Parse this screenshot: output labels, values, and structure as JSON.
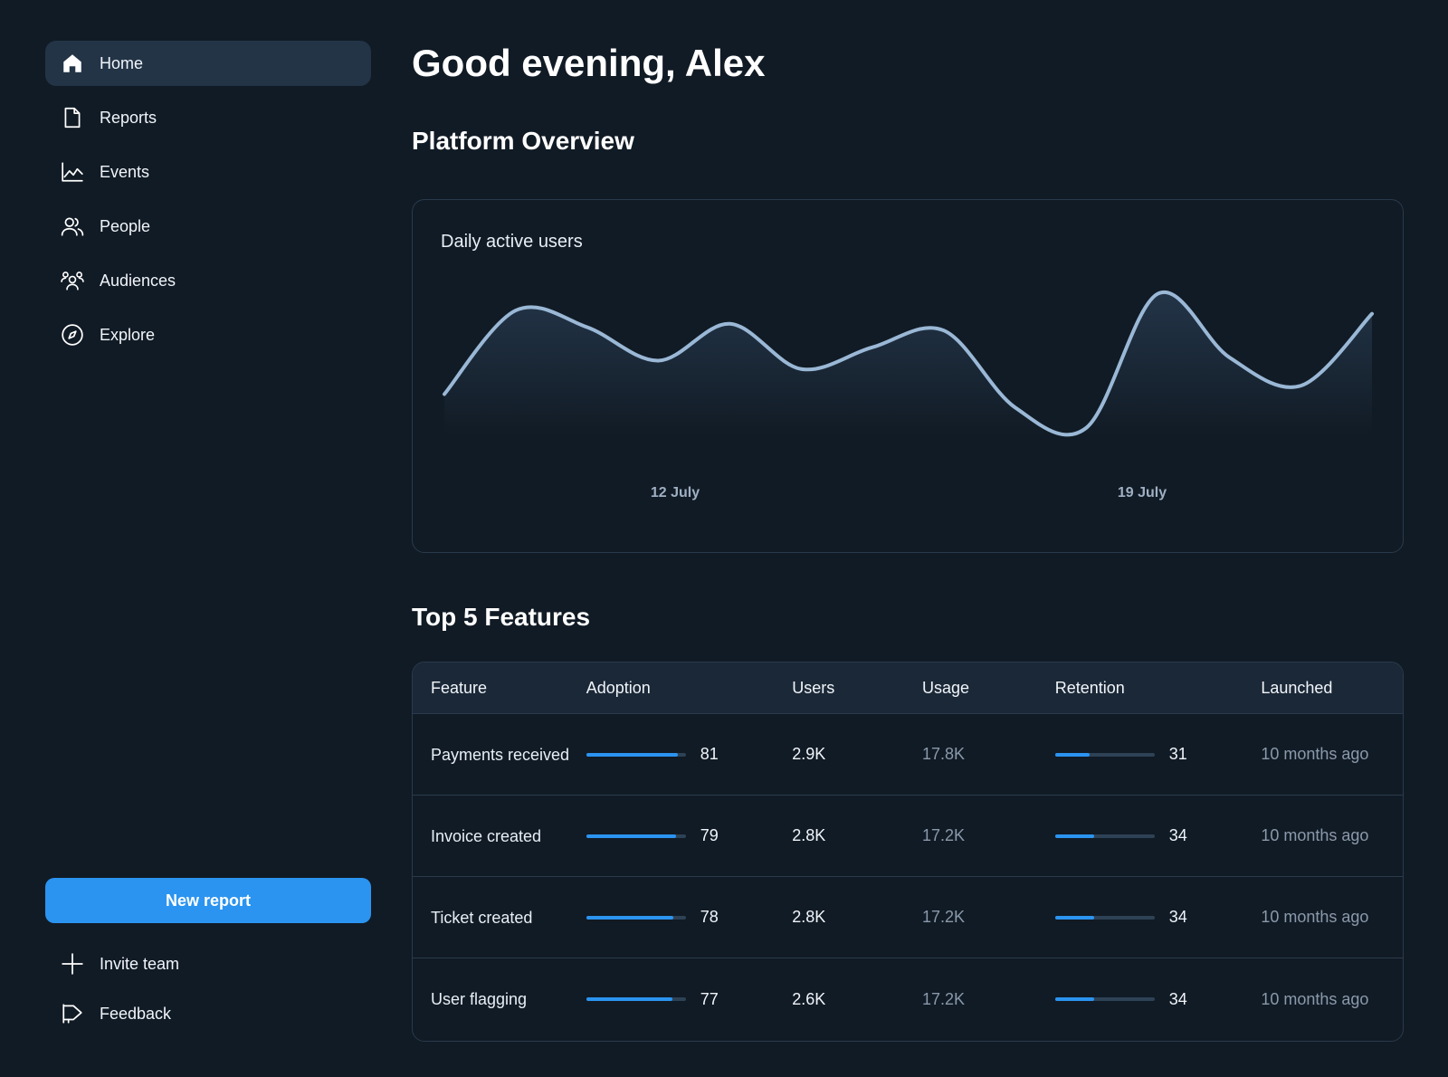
{
  "sidebar": {
    "items": [
      {
        "label": "Home",
        "icon": "home-icon",
        "active": true
      },
      {
        "label": "Reports",
        "icon": "document-icon",
        "active": false
      },
      {
        "label": "Events",
        "icon": "line-chart-icon",
        "active": false
      },
      {
        "label": "People",
        "icon": "people-icon",
        "active": false
      },
      {
        "label": "Audiences",
        "icon": "audience-icon",
        "active": false
      },
      {
        "label": "Explore",
        "icon": "compass-icon",
        "active": false
      }
    ],
    "new_report_label": "New report",
    "invite_label": "Invite team",
    "feedback_label": "Feedback"
  },
  "main": {
    "greeting": "Good evening, Alex",
    "overview_title": "Platform Overview",
    "features_title": "Top 5 Features"
  },
  "chart_data": {
    "type": "area",
    "title": "Daily active users",
    "x_tick_labels": [
      "12 July",
      "19 July"
    ],
    "values": [
      30,
      80,
      70,
      50,
      72,
      45,
      58,
      68,
      22,
      10,
      90,
      52,
      35,
      78
    ],
    "colors": {
      "line": "#9ab8d6",
      "fill_top": "#24364a"
    }
  },
  "table": {
    "headers": [
      "Feature",
      "Adoption",
      "Users",
      "Usage",
      "Retention",
      "Launched"
    ],
    "rows": [
      {
        "feature": "Payments received",
        "adoption": 81,
        "adoption_fill": 0.92,
        "users": "2.9K",
        "usage": "17.8K",
        "retention": 31,
        "retention_fill": 0.35,
        "launched": "10 months ago"
      },
      {
        "feature": "Invoice created",
        "adoption": 79,
        "adoption_fill": 0.9,
        "users": "2.8K",
        "usage": "17.2K",
        "retention": 34,
        "retention_fill": 0.39,
        "launched": "10 months ago"
      },
      {
        "feature": "Ticket created",
        "adoption": 78,
        "adoption_fill": 0.88,
        "users": "2.8K",
        "usage": "17.2K",
        "retention": 34,
        "retention_fill": 0.39,
        "launched": "10 months ago"
      },
      {
        "feature": "User flagging",
        "adoption": 77,
        "adoption_fill": 0.87,
        "users": "2.6K",
        "usage": "17.2K",
        "retention": 34,
        "retention_fill": 0.39,
        "launched": "10 months ago"
      }
    ]
  },
  "colors": {
    "accent": "#2b94f0",
    "background": "#111b25",
    "active_nav": "#233447"
  }
}
